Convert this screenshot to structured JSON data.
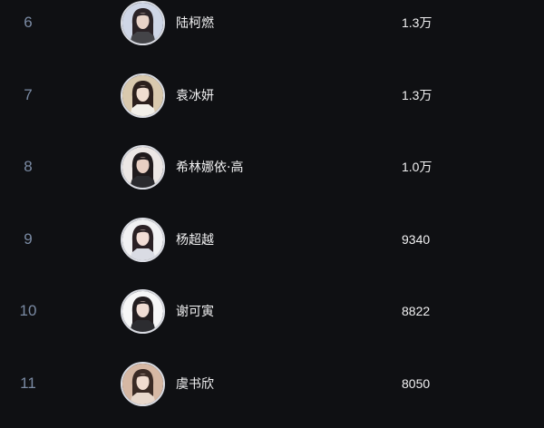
{
  "ranking": {
    "rows": [
      {
        "rank": "6",
        "name": "陆柯燃",
        "count": "1.3万",
        "avatar_bg": "#cfd6e6",
        "avatar_hair": "#2a2226",
        "avatar_skin": "#e8d3c8",
        "avatar_cloth": "#444448"
      },
      {
        "rank": "7",
        "name": "袁冰妍",
        "count": "1.3万",
        "avatar_bg": "#d9c9ae",
        "avatar_hair": "#2b1f1c",
        "avatar_skin": "#f0ddd0",
        "avatar_cloth": "#f2efe9"
      },
      {
        "rank": "8",
        "name": "希林娜依·高",
        "count": "1.0万",
        "avatar_bg": "#ece7e5",
        "avatar_hair": "#1f1a1c",
        "avatar_skin": "#e8cfc3",
        "avatar_cloth": "#2a2a2e"
      },
      {
        "rank": "9",
        "name": "杨超越",
        "count": "9340",
        "avatar_bg": "#f1f1f3",
        "avatar_hair": "#2a2024",
        "avatar_skin": "#f2ddd6",
        "avatar_cloth": "#dadce4"
      },
      {
        "rank": "10",
        "name": "谢可寅",
        "count": "8822",
        "avatar_bg": "#f6f6f7",
        "avatar_hair": "#231d20",
        "avatar_skin": "#f0dcd4",
        "avatar_cloth": "#2c2c30"
      },
      {
        "rank": "11",
        "name": "虞书欣",
        "count": "8050",
        "avatar_bg": "#d6b8a4",
        "avatar_hair": "#3a2a24",
        "avatar_skin": "#f1dccf",
        "avatar_cloth": "#e8d8cc"
      }
    ]
  },
  "colors": {
    "background": "#0f1013",
    "rank_text": "#7a8aa3",
    "primary_text": "#f1f1f2",
    "avatar_border": "#d9dbe2"
  },
  "icons": {
    "avatar": "avatar-photo-icon"
  }
}
